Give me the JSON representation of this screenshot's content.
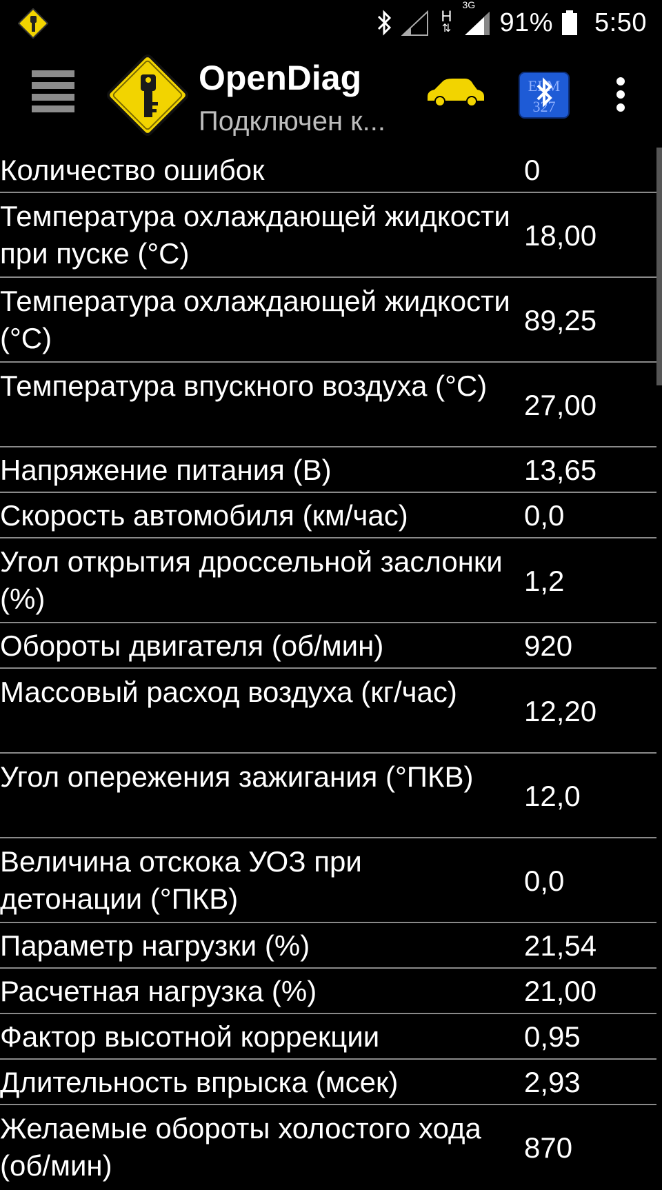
{
  "status_bar": {
    "app_icon": "opendiag-key-icon",
    "bluetooth_icon": "bluetooth-icon",
    "signal_icon": "signal-icon",
    "network_h": "H",
    "network_3g": "3G",
    "battery_percent": "91%",
    "battery_icon": "battery-icon",
    "time": "5:50"
  },
  "app_bar": {
    "menu_icon": "hamburger-menu-icon",
    "title": "OpenDiag",
    "subtitle": "Подключен к...",
    "car_icon": "car-icon",
    "ecu_icon": "ecu-bluetooth-icon",
    "ecu_icon_text": "ELM 327",
    "overflow_icon": "more-vertical-icon"
  },
  "colors": {
    "background": "#000000",
    "text": "#ffffff",
    "subtitle": "#bdbdbd",
    "divider": "#8a8a8a",
    "logo_yellow": "#f2d400",
    "ecu_blue": "#1e5bd6"
  },
  "parameters": [
    {
      "label": "Количество ошибок",
      "value": "0"
    },
    {
      "label": "Температура охлаждающей жидкости при пуске (°С)",
      "value": "18,00"
    },
    {
      "label": "Температура охлаждающей жидкости (°С)",
      "value": "89,25"
    },
    {
      "label": "Температура впускного воздуха (°С)",
      "value": "27,00"
    },
    {
      "label": "Напряжение питания (В)",
      "value": "13,65"
    },
    {
      "label": "Скорость автомобиля (км/час)",
      "value": "0,0"
    },
    {
      "label": "Угол открытия дроссельной заслонки (%)",
      "value": "1,2"
    },
    {
      "label": "Обороты двигателя (об/мин)",
      "value": "920"
    },
    {
      "label": "Массовый расход воздуха (кг/час)",
      "value": "12,20"
    },
    {
      "label": "Угол опережения зажигания (°ПКВ)",
      "value": "12,0"
    },
    {
      "label": "Величина отскока УОЗ при детонации (°ПКВ)",
      "value": "0,0"
    },
    {
      "label": "Параметр нагрузки (%)",
      "value": "21,54"
    },
    {
      "label": "Расчетная нагрузка (%)",
      "value": "21,00"
    },
    {
      "label": "Фактор высотной коррекции",
      "value": "0,95"
    },
    {
      "label": "Длительность впрыска (мсек)",
      "value": "2,93"
    },
    {
      "label": "Желаемые обороты холостого хода (об/мин)",
      "value": "870"
    }
  ]
}
